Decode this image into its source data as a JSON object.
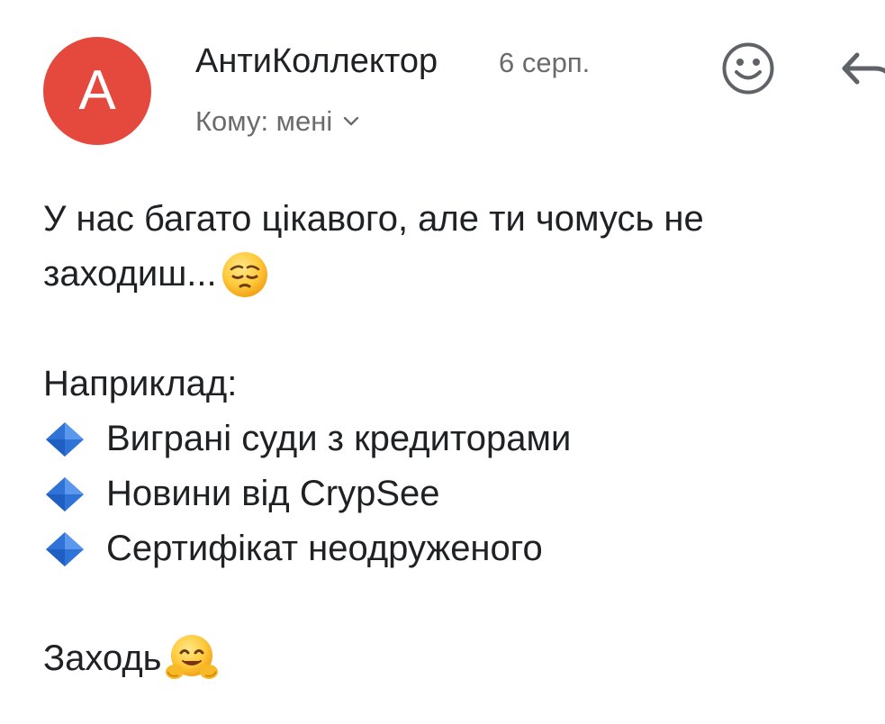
{
  "email": {
    "sender": {
      "avatar_letter": "A",
      "avatar_color": "#e5483c",
      "name": "АнтиКоллектор"
    },
    "date": "6 серп.",
    "recipients": {
      "label": "Кому: мені",
      "toggle_icon": "chevron-down-icon"
    },
    "actions": {
      "emoji_react_icon": "smiley-icon",
      "reply_icon": "reply-icon"
    },
    "body": {
      "line1": "У нас багато цікавого, але ти чомусь не",
      "line2": "заходиш...",
      "line2_emoji": "pensive-face-emoji",
      "line3": "Наприклад:",
      "bullets": [
        {
          "icon": "blue-diamond-icon",
          "text": "Виграні суди з кредиторами"
        },
        {
          "icon": "blue-diamond-icon",
          "text": "Новини від CrypSee"
        },
        {
          "icon": "blue-diamond-icon",
          "text": "Сертифікат неодруженого"
        }
      ],
      "closing": "Заходь",
      "closing_emoji": "hugging-face-emoji"
    }
  },
  "colors": {
    "avatar": "#e5483c",
    "text": "#202124",
    "secondary_text": "#6b6b6b",
    "bullet_blue": "#2f72d8"
  }
}
